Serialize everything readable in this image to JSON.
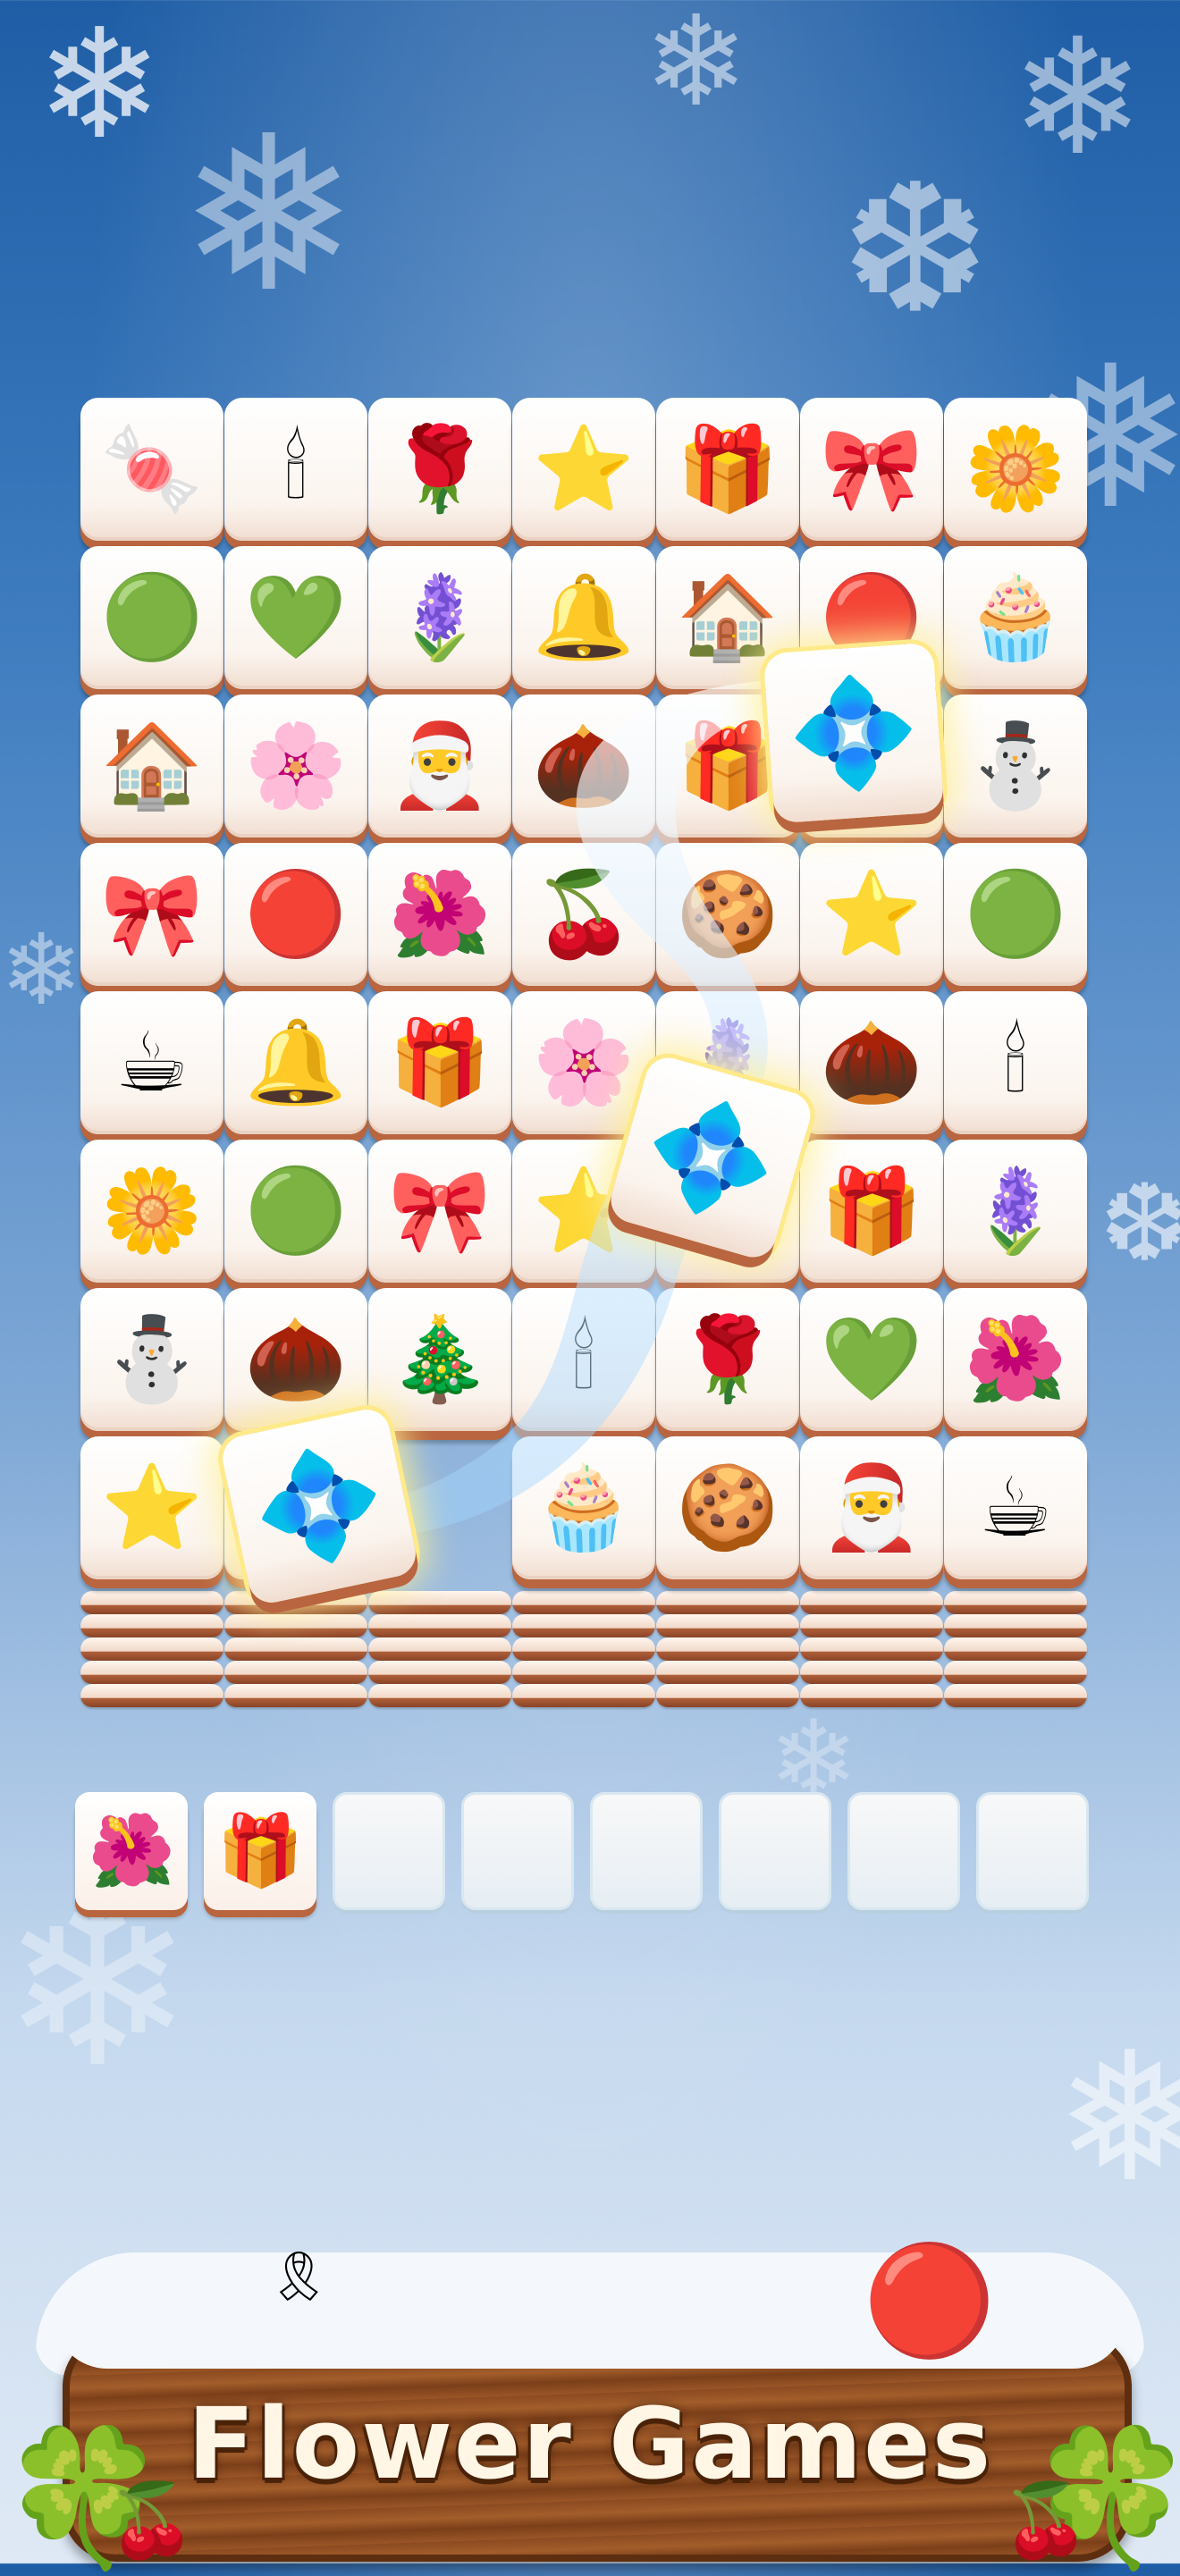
{
  "game": {
    "title": "Flower Games"
  },
  "board": {
    "columns": 7,
    "rows": [
      [
        "candy-cane",
        "candle",
        "red-camellia",
        "gold-star",
        "gift-box",
        "red-bow",
        "white-flower"
      ],
      [
        "green-ornament",
        "wreath",
        "purple-flowers",
        "bell",
        "snow-globe",
        "striped-ornament",
        "cupcake"
      ],
      [
        "snow-globe",
        "hellebore-flower",
        "santa",
        "pinecone",
        "gift-box",
        "blue-poinsettia",
        "snowman"
      ],
      [
        "red-bow",
        "striped-ornament",
        "pink-poinsettia",
        "red-berries",
        "gingerbread-man",
        "gold-star",
        "green-ornament"
      ],
      [
        "hot-cocoa",
        "bell",
        "gift-box",
        "hellebore-flower",
        "purple-flowers",
        "pinecone",
        "candle"
      ],
      [
        "white-flower",
        "green-ornament",
        "red-bow",
        "gold-star",
        "blue-poinsettia",
        "gift-box",
        "purple-flowers"
      ],
      [
        "snowman",
        "pinecone",
        "christmas-tree",
        "candle",
        "red-camellia",
        "wreath",
        "pink-poinsettia"
      ],
      [
        "gold-star",
        "blue-poinsettia",
        "",
        "cupcake",
        "gingerbread-man",
        "santa",
        "hot-cocoa"
      ]
    ],
    "selected_tiles": [
      "blue-poinsettia",
      "blue-poinsettia",
      "blue-poinsettia"
    ]
  },
  "tray": {
    "capacity": 8,
    "slots": [
      "pink-poinsettia",
      "gift-box",
      "",
      "",
      "",
      "",
      "",
      ""
    ]
  },
  "icons": {
    "candy-cane": "🍬",
    "candle": "🕯",
    "red-camellia": "🌹",
    "gold-star": "⭐",
    "gift-box": "🎁",
    "red-bow": "🎀",
    "white-flower": "🌼",
    "green-ornament": "🟢",
    "wreath": "💚",
    "purple-flowers": "🪻",
    "bell": "🔔",
    "snow-globe": "🏠",
    "striped-ornament": "🔴",
    "cupcake": "🧁",
    "hellebore-flower": "🌸",
    "santa": "🎅",
    "pinecone": "🌰",
    "blue-poinsettia": "💠",
    "snowman": "⛄",
    "pink-poinsettia": "🌺",
    "red-berries": "🍒",
    "gingerbread-man": "🍪",
    "hot-cocoa": "☕",
    "christmas-tree": "🎄"
  },
  "colors": {
    "tile_face": "#fbf4ee",
    "tile_edge": "#b9653f",
    "selected_glow": "#ffe27a",
    "banner_wood": "#9a5526",
    "banner_text": "#fff6e6"
  }
}
